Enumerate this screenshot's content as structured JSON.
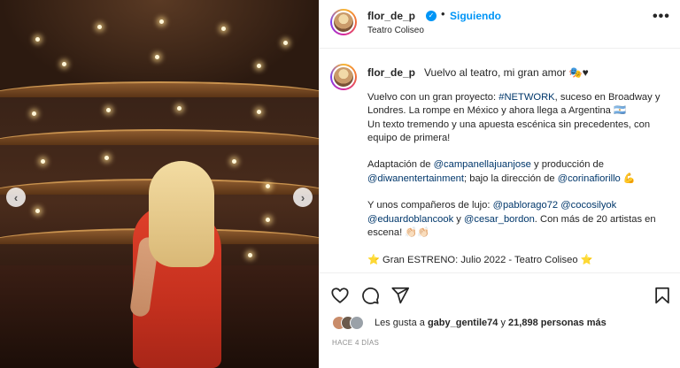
{
  "post": {
    "username": "flor_de_p",
    "follow_status": "Siguiendo",
    "location": "Teatro Coliseo",
    "dot": "•",
    "more_label": "•••"
  },
  "caption": {
    "first_line": "Vuelvo al teatro, mi gran amor 🎭♥",
    "p1_a": "Vuelvo con un gran proyecto: ",
    "p1_tag": "#NETWORK",
    "p1_b": ", suceso en Broadway y",
    "p1_c": "Londres. La rompe en México y ahora llega a Argentina 🇦🇷",
    "p1_d": "Un texto tremendo y una apuesta escénica sin precedentes, con",
    "p1_e": "equipo de primera!",
    "p2_a": "Adaptación de ",
    "p2_m1": "@campanellajuanjose",
    "p2_b": " y producción de",
    "p2_m2": "@diwanentertainment",
    "p2_c": "; bajo la dirección de ",
    "p2_m3": "@corinafiorillo",
    "p2_d": " 💪",
    "p3_a": "Y unos compañeros de lujo: ",
    "p3_m1": "@pablorago72",
    "p3_m2": "@cocosilyok",
    "p3_m3": "@eduardoblancook",
    "p3_b": " y ",
    "p3_m4": "@cesar_bordon",
    "p3_c": ". Con más de 20 artistas en",
    "p3_d": "escena! 👏🏻👏🏻",
    "p4": "⭐ Gran ESTRENO: Julio 2022 - Teatro Coliseo ⭐"
  },
  "likes": {
    "prefix": "Les gusta a ",
    "user": "gaby_gentile74",
    "mid": " y ",
    "count": "21,898 personas más"
  },
  "time_ago": "HACE 4 DÍAS",
  "colors": {
    "link": "#00376b",
    "follow": "#0095f6",
    "muted": "#8e8e8e"
  },
  "icons": [
    "heart-icon",
    "comment-icon",
    "share-icon",
    "bookmark-icon",
    "verified-icon",
    "chevron-left-icon",
    "chevron-right-icon"
  ]
}
